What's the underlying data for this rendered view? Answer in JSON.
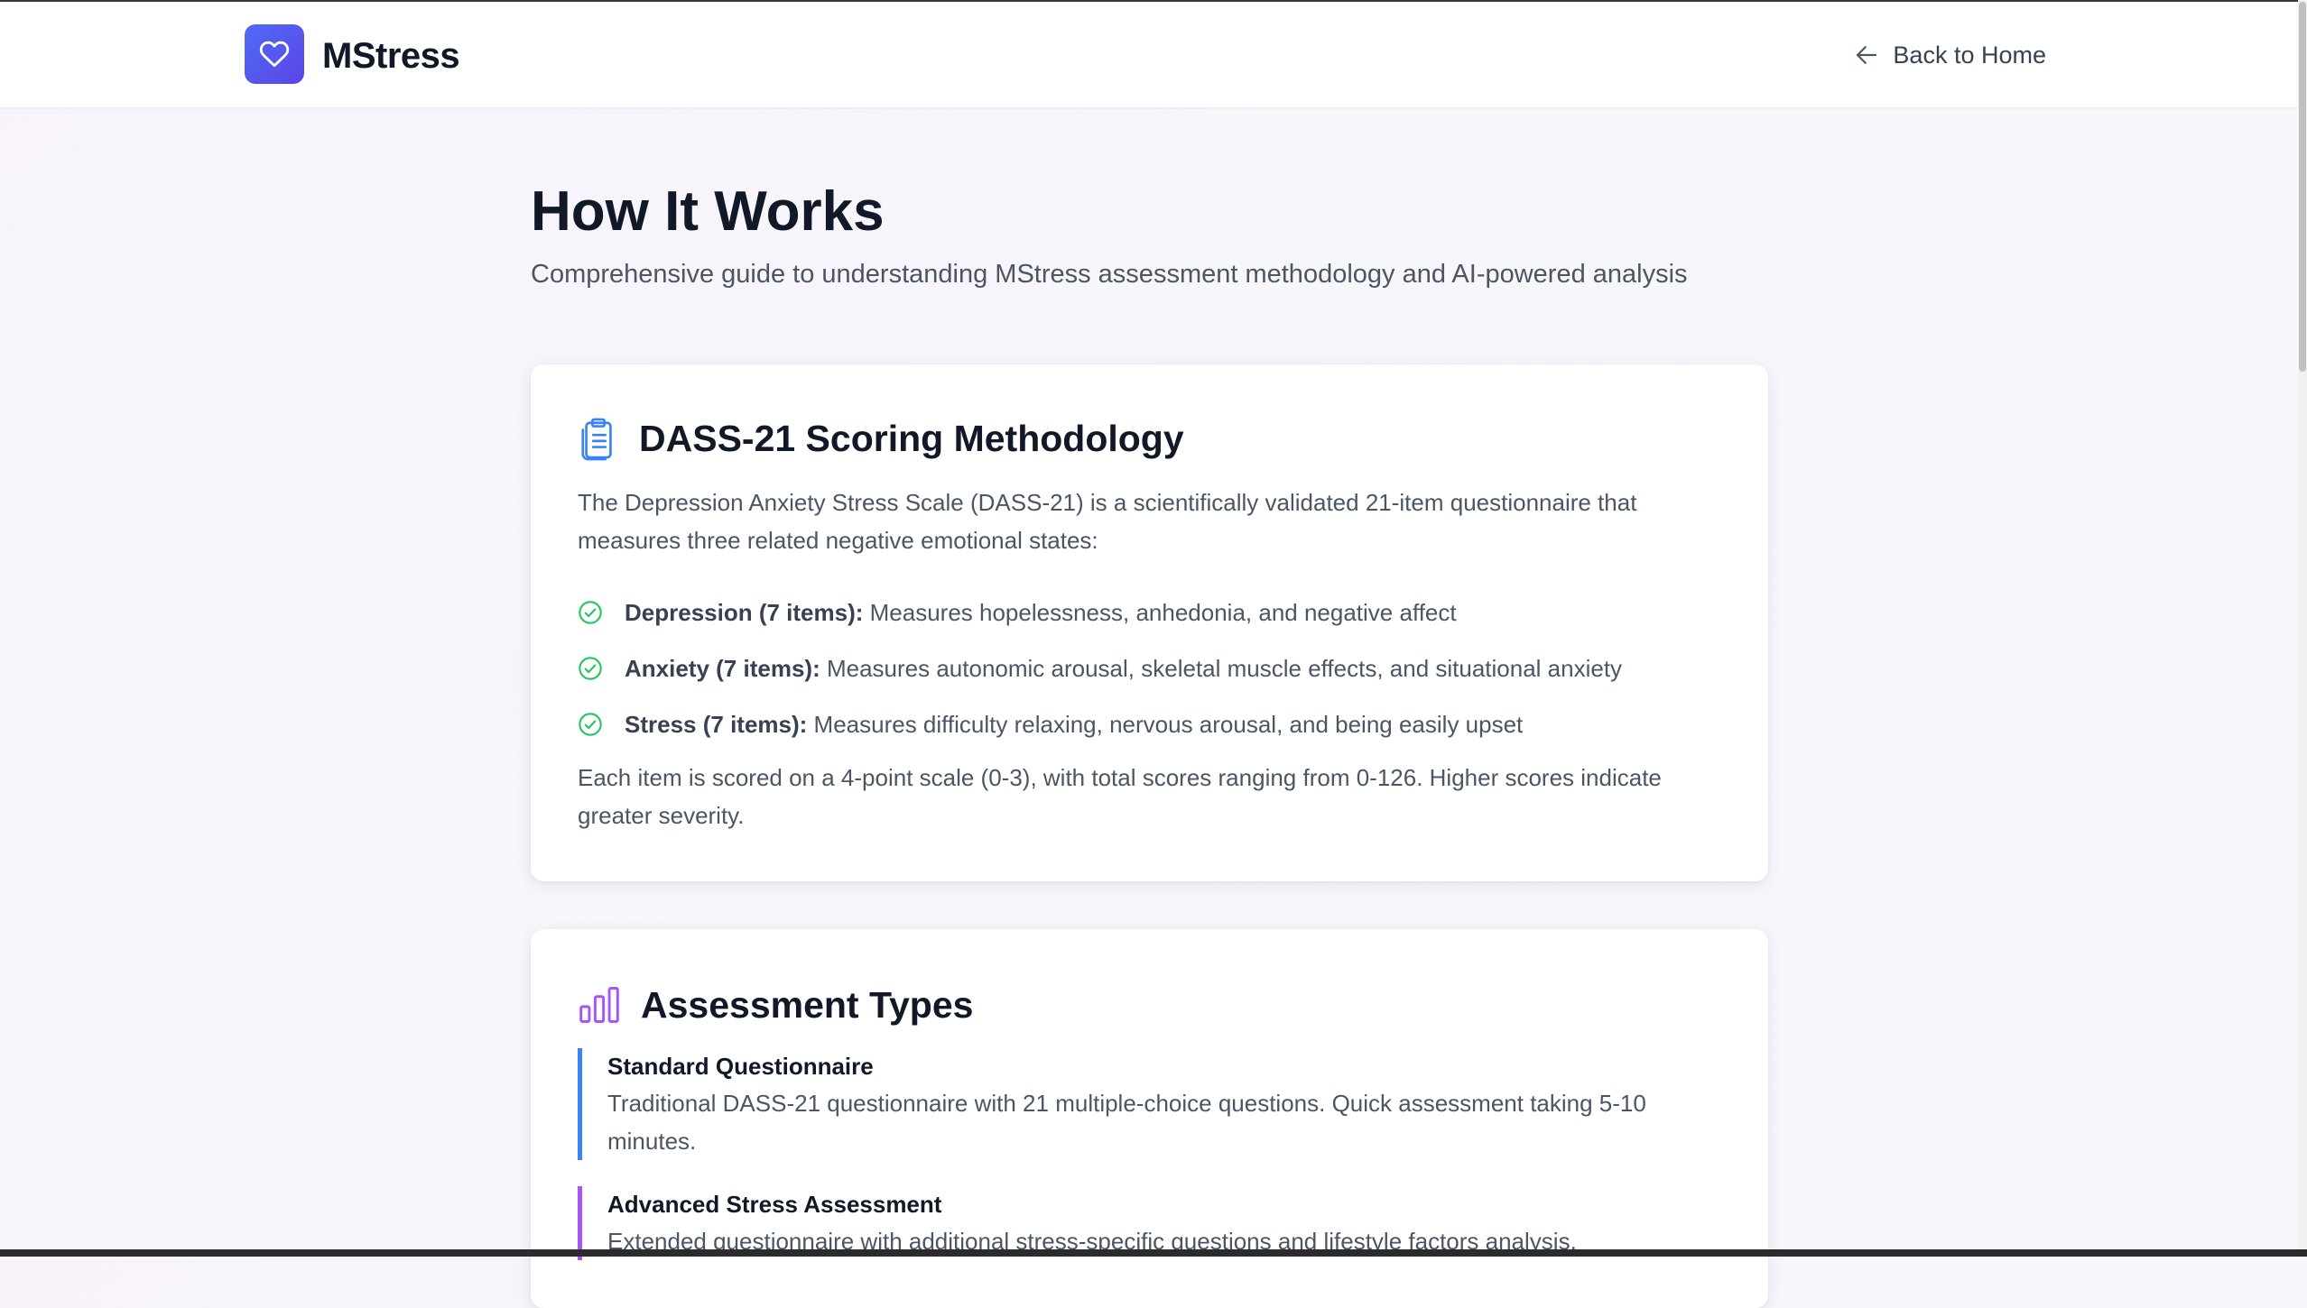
{
  "header": {
    "brand": "MStress",
    "back_label": "Back to Home"
  },
  "page": {
    "title": "How It Works",
    "subtitle": "Comprehensive guide to understanding MStress assessment methodology and AI-powered analysis"
  },
  "dass_card": {
    "title": "DASS-21 Scoring Methodology",
    "intro": "The Depression Anxiety Stress Scale (DASS-21) is a scientifically validated 21-item questionnaire that measures three related negative emotional states:",
    "items": [
      {
        "label": "Depression (7 items):",
        "text": " Measures hopelessness, anhedonia, and negative affect"
      },
      {
        "label": "Anxiety (7 items):",
        "text": " Measures autonomic arousal, skeletal muscle effects, and situational anxiety"
      },
      {
        "label": "Stress (7 items):",
        "text": " Measures difficulty relaxing, nervous arousal, and being easily upset"
      }
    ],
    "outro": "Each item is scored on a 4-point scale (0-3), with total scores ranging from 0-126. Higher scores indicate greater severity."
  },
  "types_card": {
    "title": "Assessment Types",
    "types": [
      {
        "title": "Standard Questionnaire",
        "desc": "Traditional DASS-21 questionnaire with 21 multiple-choice questions. Quick assessment taking 5-10 minutes."
      },
      {
        "title": "Advanced Stress Assessment",
        "desc": "Extended questionnaire with additional stress-specific questions and lifestyle factors analysis."
      }
    ]
  },
  "colors": {
    "brand_gradient_start": "#4f6cf5",
    "brand_gradient_end": "#5a45e6",
    "check_green": "#22c55e",
    "clipboard_blue": "#3b82f6",
    "chart_purple": "#a855f7",
    "type_border_blue": "#3b82f6",
    "type_border_purple": "#a855f7"
  },
  "icons": {
    "logo": "heart-icon",
    "back": "arrow-left-icon",
    "dass": "clipboard-icon",
    "types": "bar-chart-icon",
    "check": "check-circle-icon"
  }
}
